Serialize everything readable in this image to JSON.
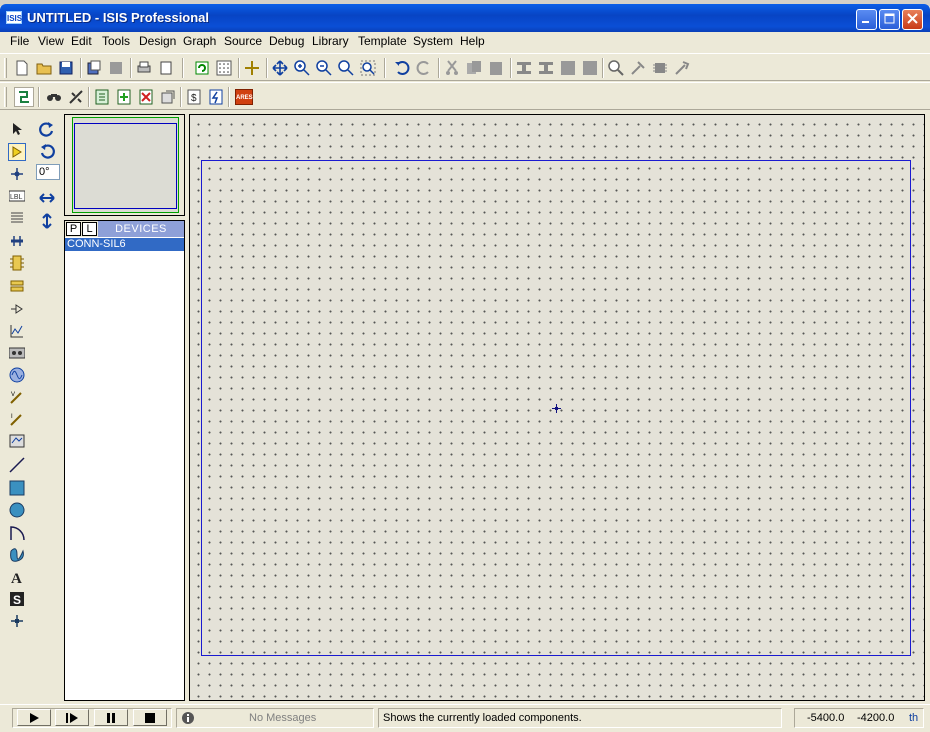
{
  "window": {
    "title": "UNTITLED - ISIS Professional",
    "app_icon_text": "ISIS",
    "buttons": {
      "minimize": "minimize-icon",
      "maximize": "maximize-icon",
      "close": "close-icon"
    }
  },
  "menu": {
    "items": [
      {
        "label": "File"
      },
      {
        "label": "View"
      },
      {
        "label": "Edit"
      },
      {
        "label": "Tools"
      },
      {
        "label": "Design"
      },
      {
        "label": "Graph"
      },
      {
        "label": "Source"
      },
      {
        "label": "Debug"
      },
      {
        "label": "Library"
      },
      {
        "label": "Template"
      },
      {
        "label": "System"
      },
      {
        "label": "Help"
      }
    ]
  },
  "toolbar1": {
    "icons": [
      "new-file-icon",
      "open-folder-icon",
      "save-icon",
      "import-section-icon",
      "export-section-icon",
      "print-icon",
      "set-area-icon",
      "refresh-icon",
      "grid-icon",
      "false-origin-icon",
      "pan-icon",
      "zoom-in-icon",
      "zoom-out-icon",
      "zoom-all-icon",
      "zoom-area-icon",
      "undo-icon",
      "redo-icon",
      "cut-icon",
      "copy-icon",
      "paste-icon",
      "block-copy-icon",
      "block-move-icon",
      "block-rotate-icon",
      "block-delete-icon",
      "pick-device-icon",
      "make-device-icon",
      "packaging-tool-icon",
      "decompose-icon"
    ]
  },
  "toolbar2": {
    "icons": [
      "wire-autorouter-icon",
      "search-tag-icon",
      "property-assignment-icon",
      "design-explorer-icon",
      "new-sheet-icon",
      "remove-sheet-icon",
      "goto-child-icon",
      "bill-of-materials-icon",
      "electrical-rule-check-icon"
    ],
    "ares_label": "ARES"
  },
  "mode_tools": [
    "selection-mode-icon",
    "component-mode-icon",
    "junction-dot-icon",
    "wire-label-icon",
    "text-script-icon",
    "buses-icon",
    "subcircuit-icon",
    "terminals-icon",
    "device-pins-icon",
    "graph-mode-icon",
    "tape-recorder-icon",
    "generator-icon",
    "voltage-probe-icon",
    "current-probe-icon",
    "virtual-instruments-icon",
    "line-icon",
    "box-icon",
    "circle-icon",
    "arc-icon",
    "closed-path-icon",
    "text-icon",
    "symbol-icon",
    "marker-icon"
  ],
  "rotation": {
    "rotate_cw": "rotate-clockwise-icon",
    "rotate_ccw": "rotate-anticlockwise-icon",
    "angle": "0°",
    "mirror_x": "mirror-horizontal-icon",
    "mirror_y": "mirror-vertical-icon"
  },
  "devices": {
    "pick_button": "P",
    "library_button": "L",
    "header": "DEVICES",
    "items": [
      {
        "name": "CONN-SIL6",
        "selected": true
      }
    ]
  },
  "status": {
    "messages": "No Messages",
    "hint": "Shows the currently loaded components.",
    "coord_x": "-5400.0",
    "coord_y": "-4200.0",
    "units": "th"
  },
  "colors": {
    "sheet_border": "#1a1ad0",
    "selection": "#316ac5",
    "devices_header": "#8ea0d8",
    "title_bar": "#0a4fd6"
  }
}
